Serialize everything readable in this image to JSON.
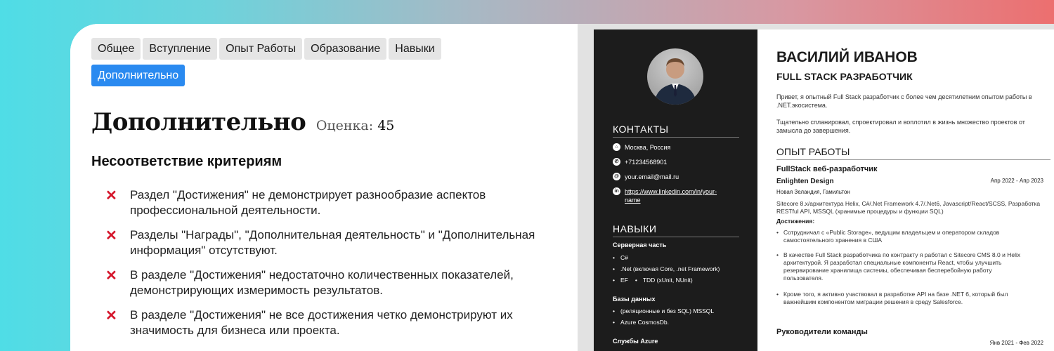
{
  "tabs": [
    "Общее",
    "Вступление",
    "Опыт Работы",
    "Образование",
    "Навыки",
    "Дополнительно"
  ],
  "active_tab": "Дополнительно",
  "section": {
    "title": "Дополнительно",
    "score_label": "Оценка:",
    "score_value": "45",
    "subheading": "Несоответствие критериям",
    "issues": [
      "Раздел \"Достижения\" не демонстрирует разнообразие аспектов профессиональной деятельности.",
      "Разделы \"Награды\", \"Дополнительная деятельность\" и \"Дополнительная информация\" отсутствуют.",
      "В разделе \"Достижения\" недостаточно количественных показателей, демонстрирующих измеримость результатов.",
      "В разделе \"Достижения\" не все достижения четко демонстрируют их значимость для бизнеса или проекта."
    ]
  },
  "resume": {
    "contacts_title": "КОНТАКТЫ",
    "contacts": {
      "location": "Москва, Россия",
      "phone": "+71234568901",
      "email": "your.email@mail.ru",
      "linkedin": "https://www.linkedin.com/in/your-name"
    },
    "skills_title": "НАВЫКИ",
    "skills": {
      "server_group": "Серверная часть",
      "server": [
        "C#",
        ".Net (включая Core, .net Framework)",
        "EF",
        "TDD (xUnit, NUnit)"
      ],
      "db_group": "Базы данных",
      "db": [
        "(реляционные и без SQL) MSSQL",
        "Azure CosmosDb."
      ],
      "azure_group": "Службы Azure"
    },
    "name": "ВАСИЛИЙ ИВАНОВ",
    "role": "FULL STACK РАЗРАБОТЧИК",
    "summary_1": "Привет, я опытный Full Stack разработчик с более чем десятилетним опытом работы в .NET.экосистема.",
    "summary_2": "Тщательно спланировал, спроектировал и воплотил в жизнь множество проектов от замысла до завершения.",
    "experience_title": "ОПЫТ РАБОТЫ",
    "job1": {
      "title": "FullStack веб-разработчик",
      "company": "Enlighten Design",
      "dates": "Апр 2022 - Апр 2023",
      "location": "Новая Зеландия, Гамильтон",
      "stack": "Sitecore 8.x/архитектура Helix, C#/.Net Framework 4.7/.Net6, Javascript/React/SCSS, Разработка RESTful API, MSSQL (хранимые процедуры и функции SQL)",
      "achievements_label": "Достижения:",
      "achievements": [
        "Сотрудничал с «Public Storage», ведущим владельцем и оператором складов самостоятельного хранения в США",
        "В качестве Full Stack разработчика по контракту я работал с Sitecore CMS 8.0 и Helix архитектурой. Я разработал специальные компоненты React, чтобы улучшить резервирование хранилища системы, обеспечивая бесперебойную работу пользователя.",
        "Кроме того, я активно участвовал в разработке API на базе .NET 6, который был важнейшим компонентом миграции решения в среду Salesforce."
      ]
    },
    "job2": {
      "title": "Руководители команды",
      "dates": "Янв 2021 - Фев 2022"
    }
  },
  "colors": {
    "active_tab": "#2a8af0",
    "issue_mark": "#d5152a",
    "sidebar_bg": "#1c1c1c"
  },
  "icons": [
    "cross-icon",
    "location-icon",
    "phone-icon",
    "email-icon",
    "linkedin-icon"
  ]
}
